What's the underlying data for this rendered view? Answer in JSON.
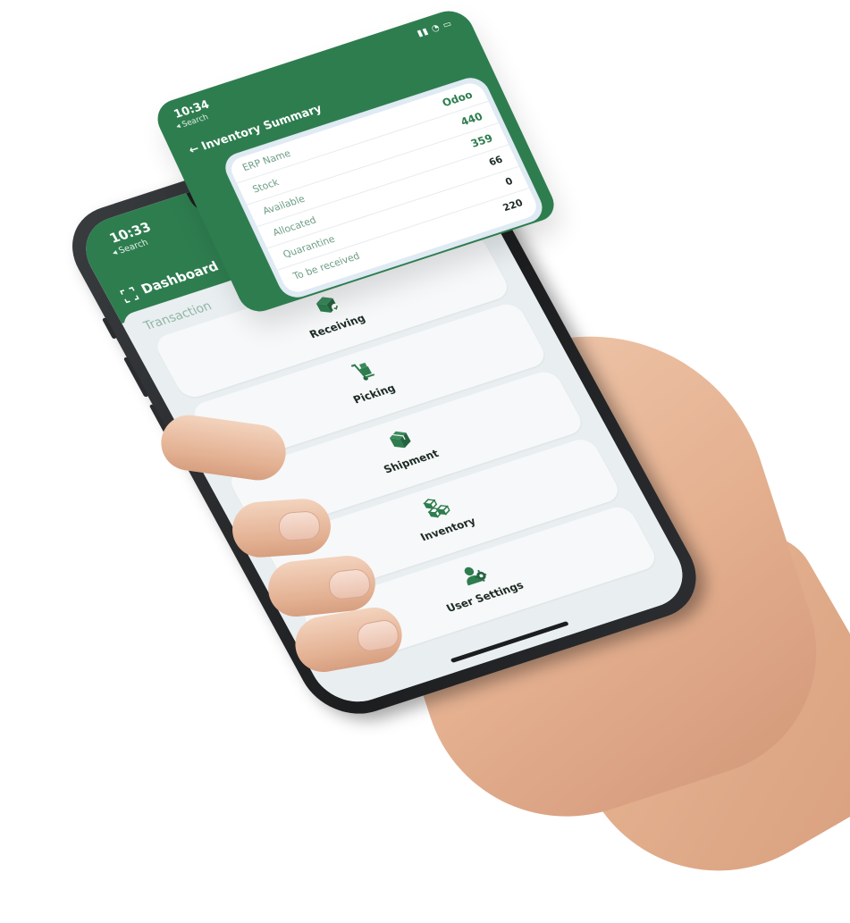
{
  "dashboard": {
    "status_time": "10:33",
    "back_hint": "◂ Search",
    "title": "Dashboard",
    "section_label": "Transaction",
    "tiles": [
      {
        "label": "Receiving",
        "icon": "receiving-icon"
      },
      {
        "label": "Picking",
        "icon": "hand-truck-icon"
      },
      {
        "label": "Shipment",
        "icon": "box-icon"
      },
      {
        "label": "Inventory",
        "icon": "stacked-boxes-icon"
      },
      {
        "label": "User Settings",
        "icon": "user-gear-icon"
      }
    ]
  },
  "summary": {
    "status_time": "10:34",
    "back_hint": "◂ Search",
    "title": "Inventory Summary",
    "rows": [
      {
        "label": "ERP Name",
        "value": "Odoo"
      },
      {
        "label": "Stock",
        "value": "440"
      },
      {
        "label": "Available",
        "value": "359"
      },
      {
        "label": "Allocated",
        "value": "66"
      },
      {
        "label": "Quarantine",
        "value": "0"
      },
      {
        "label": "To be received",
        "value": "220"
      }
    ]
  },
  "colors": {
    "brand_green": "#2e7d4f",
    "screen_background": "#e9eef1",
    "label_green": "#6c9d84"
  }
}
